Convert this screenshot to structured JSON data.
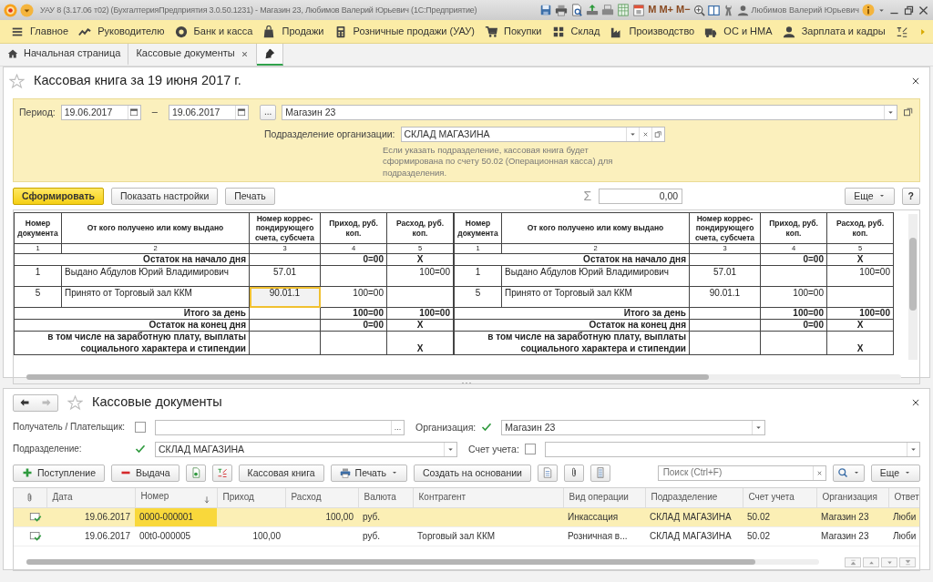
{
  "window": {
    "title": "УАУ 8 (3.17.06 т02) (БухгалтерияПредприятия 3.0.50.1231) - Магазин 23, Любимов Валерий Юрьевич  (1С:Предприятие)",
    "memory_buttons": [
      "M",
      "M+",
      "M−"
    ],
    "user": "Любимов Валерий Юрьевич"
  },
  "sections": [
    {
      "label": "Главное"
    },
    {
      "label": "Руководителю"
    },
    {
      "label": "Банк и касса"
    },
    {
      "label": "Продажи"
    },
    {
      "label": "Розничные продажи (УАУ)"
    },
    {
      "label": "Покупки"
    },
    {
      "label": "Склад"
    },
    {
      "label": "Производство"
    },
    {
      "label": "ОС и НМА"
    },
    {
      "label": "Зарплата и кадры"
    }
  ],
  "tabs": [
    {
      "kind": "home",
      "label": "Начальная страница",
      "selected": false,
      "closable": false
    },
    {
      "kind": "text",
      "label": "Кассовые документы",
      "selected": false,
      "closable": true
    },
    {
      "kind": "pin",
      "selected": true,
      "closable": false
    }
  ],
  "report": {
    "title": "Кассовая книга за 19 июня 2017 г.",
    "period_label": "Период:",
    "date_from": "19.06.2017",
    "date_separator": "–",
    "date_to": "19.06.2017",
    "choose_period": "...",
    "organization": "Магазин 23",
    "subdivision_label": "Подразделение организации:",
    "subdivision": "СКЛАД МАГАЗИНА",
    "hint": "Если указать подразделение, кассовая книга будет сформирована по счету 50.02 (Операционная касса) для подразделения.",
    "buttons": [
      {
        "label": "Сформировать",
        "default": true
      },
      {
        "label": "Показать настройки",
        "default": false
      },
      {
        "label": "Печать",
        "default": false
      }
    ],
    "sum_sign": "Σ",
    "sum": "0,00",
    "more": "Еще",
    "help": "?",
    "pages": [
      {
        "columns": [
          "Номер документа",
          "От кого получено или кому выдано",
          "Номер коррес-пондирующего счета, субсчета",
          "Приход, руб. коп.",
          "Расход, руб. коп."
        ],
        "column_numbers": [
          "1",
          "2",
          "3",
          "4",
          "5"
        ],
        "rows": [
          {
            "kind": "summary",
            "label": "Остаток на начало дня",
            "income": "0=00",
            "expense": "X"
          },
          {
            "kind": "entry",
            "number": "1",
            "party": "Выдано Абдулов Юрий Владимирович",
            "account": "57.01",
            "expense": "100=00",
            "selected": false
          },
          {
            "kind": "entry",
            "number": "5",
            "party": "Принято от Торговый зал ККМ",
            "account": "90.01.1",
            "income": "100=00",
            "selected": true
          },
          {
            "kind": "summary",
            "label": "Итого за день",
            "income": "100=00",
            "expense": "100=00"
          },
          {
            "kind": "summary",
            "label": "Остаток на конец  дня",
            "income": "0=00",
            "expense": "X"
          },
          {
            "kind": "summary",
            "label": "в том числе на заработную плату, выплаты социального характера и стипендии",
            "expense": "X"
          }
        ]
      },
      {
        "columns": [
          "Номер документа",
          "От кого получено или кому выдано",
          "Номер коррес-пондирующего счета, субсчета",
          "Приход, руб. коп.",
          "Расход, руб. коп."
        ],
        "column_numbers": [
          "1",
          "2",
          "3",
          "4",
          "5"
        ],
        "rows": [
          {
            "kind": "summary",
            "label": "Остаток на начало дня",
            "income": "0=00",
            "expense": "X"
          },
          {
            "kind": "entry",
            "number": "1",
            "party": "Выдано Абдулов Юрий Владимирович",
            "account": "57.01",
            "expense": "100=00",
            "selected": false
          },
          {
            "kind": "entry",
            "number": "5",
            "party": "Принято от Торговый зал ККМ",
            "account": "90.01.1",
            "income": "100=00",
            "selected": false
          },
          {
            "kind": "summary",
            "label": "Итого за день",
            "income": "100=00",
            "expense": "100=00"
          },
          {
            "kind": "summary",
            "label": "Остаток на конец  дня",
            "income": "0=00",
            "expense": "X"
          },
          {
            "kind": "summary",
            "label": "в том числе на заработную плату, выплаты социального характера и стипендии",
            "expense": "X"
          }
        ]
      }
    ]
  },
  "documents": {
    "title": "Кассовые документы",
    "filter_rows": [
      {
        "filters": [
          {
            "label": "Получатель / Плательщик:",
            "checked": false,
            "select_button": "..."
          },
          {
            "label": "Организация:",
            "checked": true,
            "value": "Магазин 23"
          }
        ]
      },
      {
        "filters": [
          {
            "label": "Подразделение:",
            "checked": true,
            "value": "СКЛАД МАГАЗИНА"
          },
          {
            "label": "Счет учета:",
            "checked": false
          }
        ]
      }
    ],
    "toolbar": [
      {
        "kind": "add",
        "label": "Поступление"
      },
      {
        "kind": "remove",
        "label": "Выдача"
      },
      {
        "kind": "copy"
      },
      {
        "kind": "ledger"
      },
      {
        "kind": "plain",
        "label": "Кассовая книга"
      },
      {
        "kind": "print",
        "label": "Печать"
      },
      {
        "kind": "plain",
        "label": "Создать на основании"
      },
      {
        "kind": "doc"
      },
      {
        "kind": "attach"
      },
      {
        "kind": "list"
      }
    ],
    "search_placeholder": "Поиск (Ctrl+F)",
    "more": "Еще",
    "columns": [
      {
        "label": "Дата",
        "sorted": false
      },
      {
        "label": "Номер",
        "sorted": true
      },
      {
        "label": "Приход",
        "sorted": false
      },
      {
        "label": "Расход",
        "sorted": false
      },
      {
        "label": "Валюта",
        "sorted": false
      },
      {
        "label": "Контрагент",
        "sorted": false
      },
      {
        "label": "Вид операции",
        "sorted": false
      },
      {
        "label": "Подразделение",
        "sorted": false
      },
      {
        "label": "Счет учета",
        "sorted": false
      },
      {
        "label": "Организация",
        "sorted": false
      },
      {
        "label": "Ответ",
        "sorted": false
      }
    ],
    "rows": [
      {
        "selected": true,
        "posted": true,
        "date": "19.06.2017",
        "number": "0000-000001",
        "expense": "100,00",
        "currency": "руб.",
        "operation": "Инкассация",
        "subdivision": "СКЛАД МАГАЗИНА",
        "account": "50.02",
        "organization": "Магазин 23",
        "responsible": "Люби"
      },
      {
        "selected": false,
        "posted": true,
        "date": "19.06.2017",
        "number": "00t0-000005",
        "income": "100,00",
        "currency": "руб.",
        "counterparty": "Торговый зал ККМ",
        "operation": "Розничная в...",
        "subdivision": "СКЛАД МАГАЗИНА",
        "account": "50.02",
        "organization": "Магазин 23",
        "responsible": "Люби"
      }
    ]
  }
}
